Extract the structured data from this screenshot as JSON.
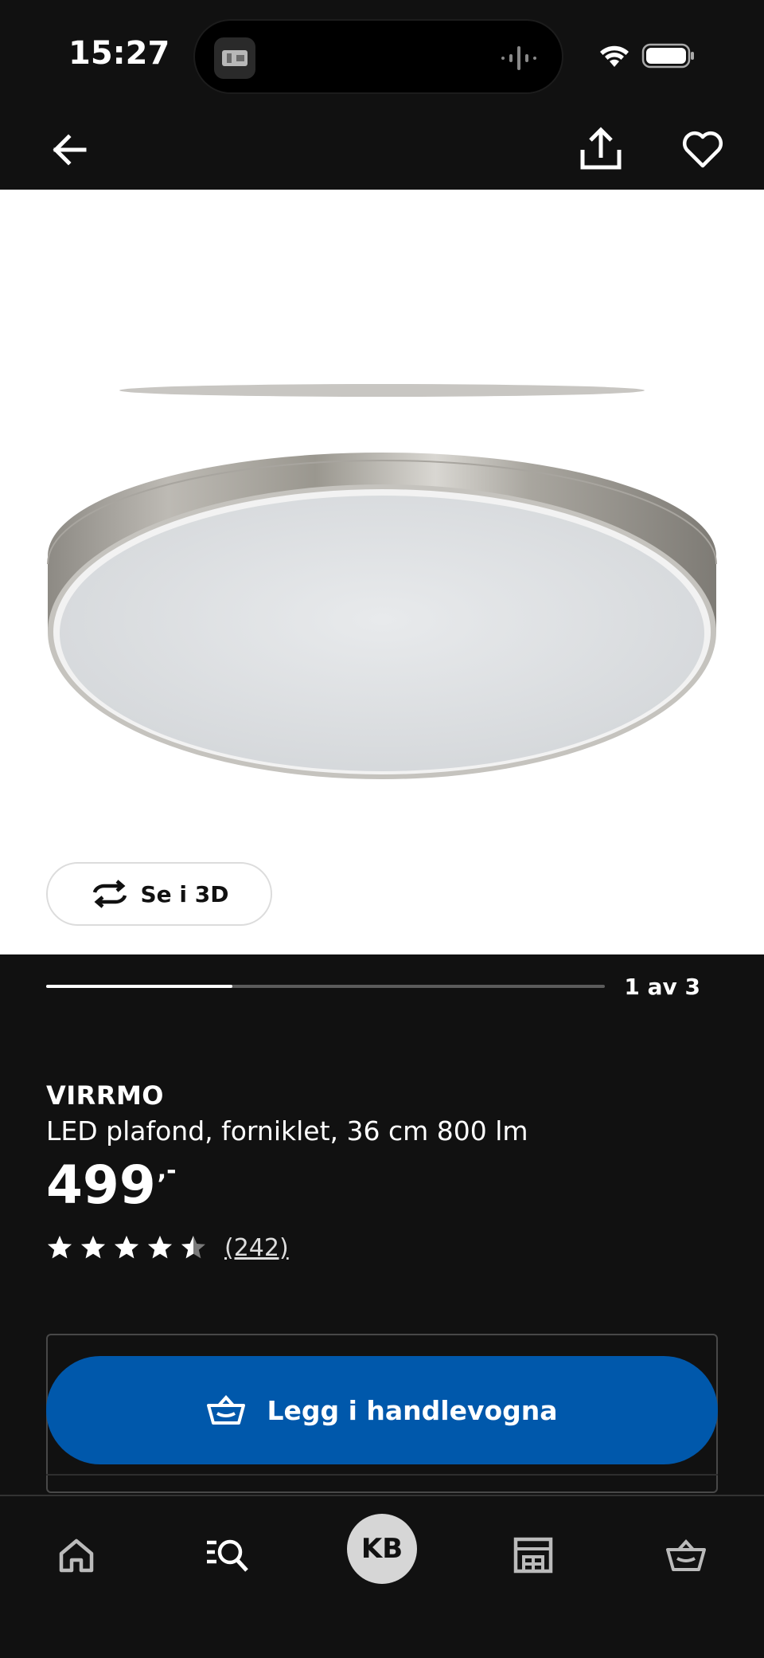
{
  "status_bar": {
    "time": "15:27"
  },
  "nav": {
    "back_icon": "arrow-left-icon",
    "share_icon": "share-icon",
    "favorite_icon": "heart-icon"
  },
  "gallery": {
    "view_3d_label": "Se i 3D",
    "pager_text": "1 av 3",
    "current": 1,
    "total": 3
  },
  "product": {
    "name": "VIRRMO",
    "description": "LED plafond, forniklet, 36 cm 800 lm",
    "price_int": "499",
    "price_dec": ",-",
    "rating": 4.5,
    "rating_max": 5,
    "review_count": "(242)"
  },
  "cart": {
    "add_label": "Legg i handlevogna"
  },
  "tab_bar": {
    "profile_initials": "KB"
  },
  "colors": {
    "background": "#111111",
    "accent": "#0058ab",
    "image_bg": "#ffffff"
  }
}
